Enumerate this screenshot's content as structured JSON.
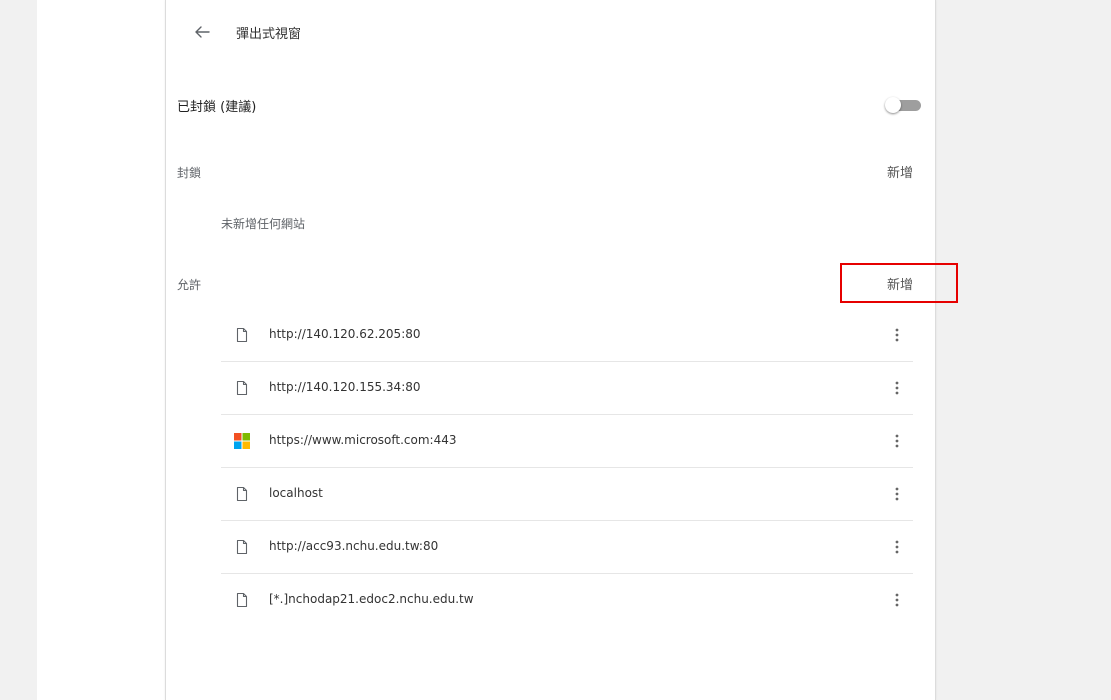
{
  "header": {
    "title": "彈出式視窗",
    "back_icon": "arrow-back-icon"
  },
  "blocked_toggle": {
    "label": "已封鎖 (建議)",
    "state": "off"
  },
  "block_section": {
    "label": "封鎖",
    "add_label": "新增",
    "empty_text": "未新增任何網站"
  },
  "allow_section": {
    "label": "允許",
    "add_label": "新增",
    "items": [
      {
        "site": "http://140.120.62.205:80",
        "icon": "file-icon"
      },
      {
        "site": "http://140.120.155.34:80",
        "icon": "file-icon"
      },
      {
        "site": "https://www.microsoft.com:443",
        "icon": "microsoft-logo-icon"
      },
      {
        "site": "localhost",
        "icon": "file-icon"
      },
      {
        "site": "http://acc93.nchu.edu.tw:80",
        "icon": "file-icon"
      },
      {
        "site": "[*.]nchodap21.edoc2.nchu.edu.tw",
        "icon": "file-icon"
      }
    ]
  },
  "colors": {
    "highlight_box": "#e60000",
    "toggle_track": "#9e9e9e",
    "side_background": "#f1f1f1"
  }
}
